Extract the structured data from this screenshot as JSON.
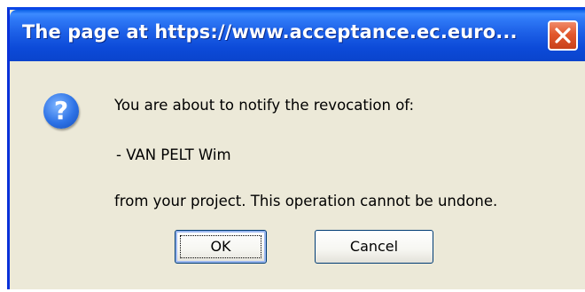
{
  "dialog": {
    "title": "The page at https://www.acceptance.ec.euro...",
    "icon": "question-icon",
    "icon_glyph": "?",
    "message_line1": "You are about to notify the revocation of:",
    "message_line2": "- VAN PELT Wim",
    "message_line3": "from your project. This operation cannot be undone.",
    "ok_label": "OK",
    "cancel_label": "Cancel"
  },
  "colors": {
    "titlebar": "#0a44cc",
    "body": "#ece9d8",
    "close_button": "#e2582d"
  }
}
